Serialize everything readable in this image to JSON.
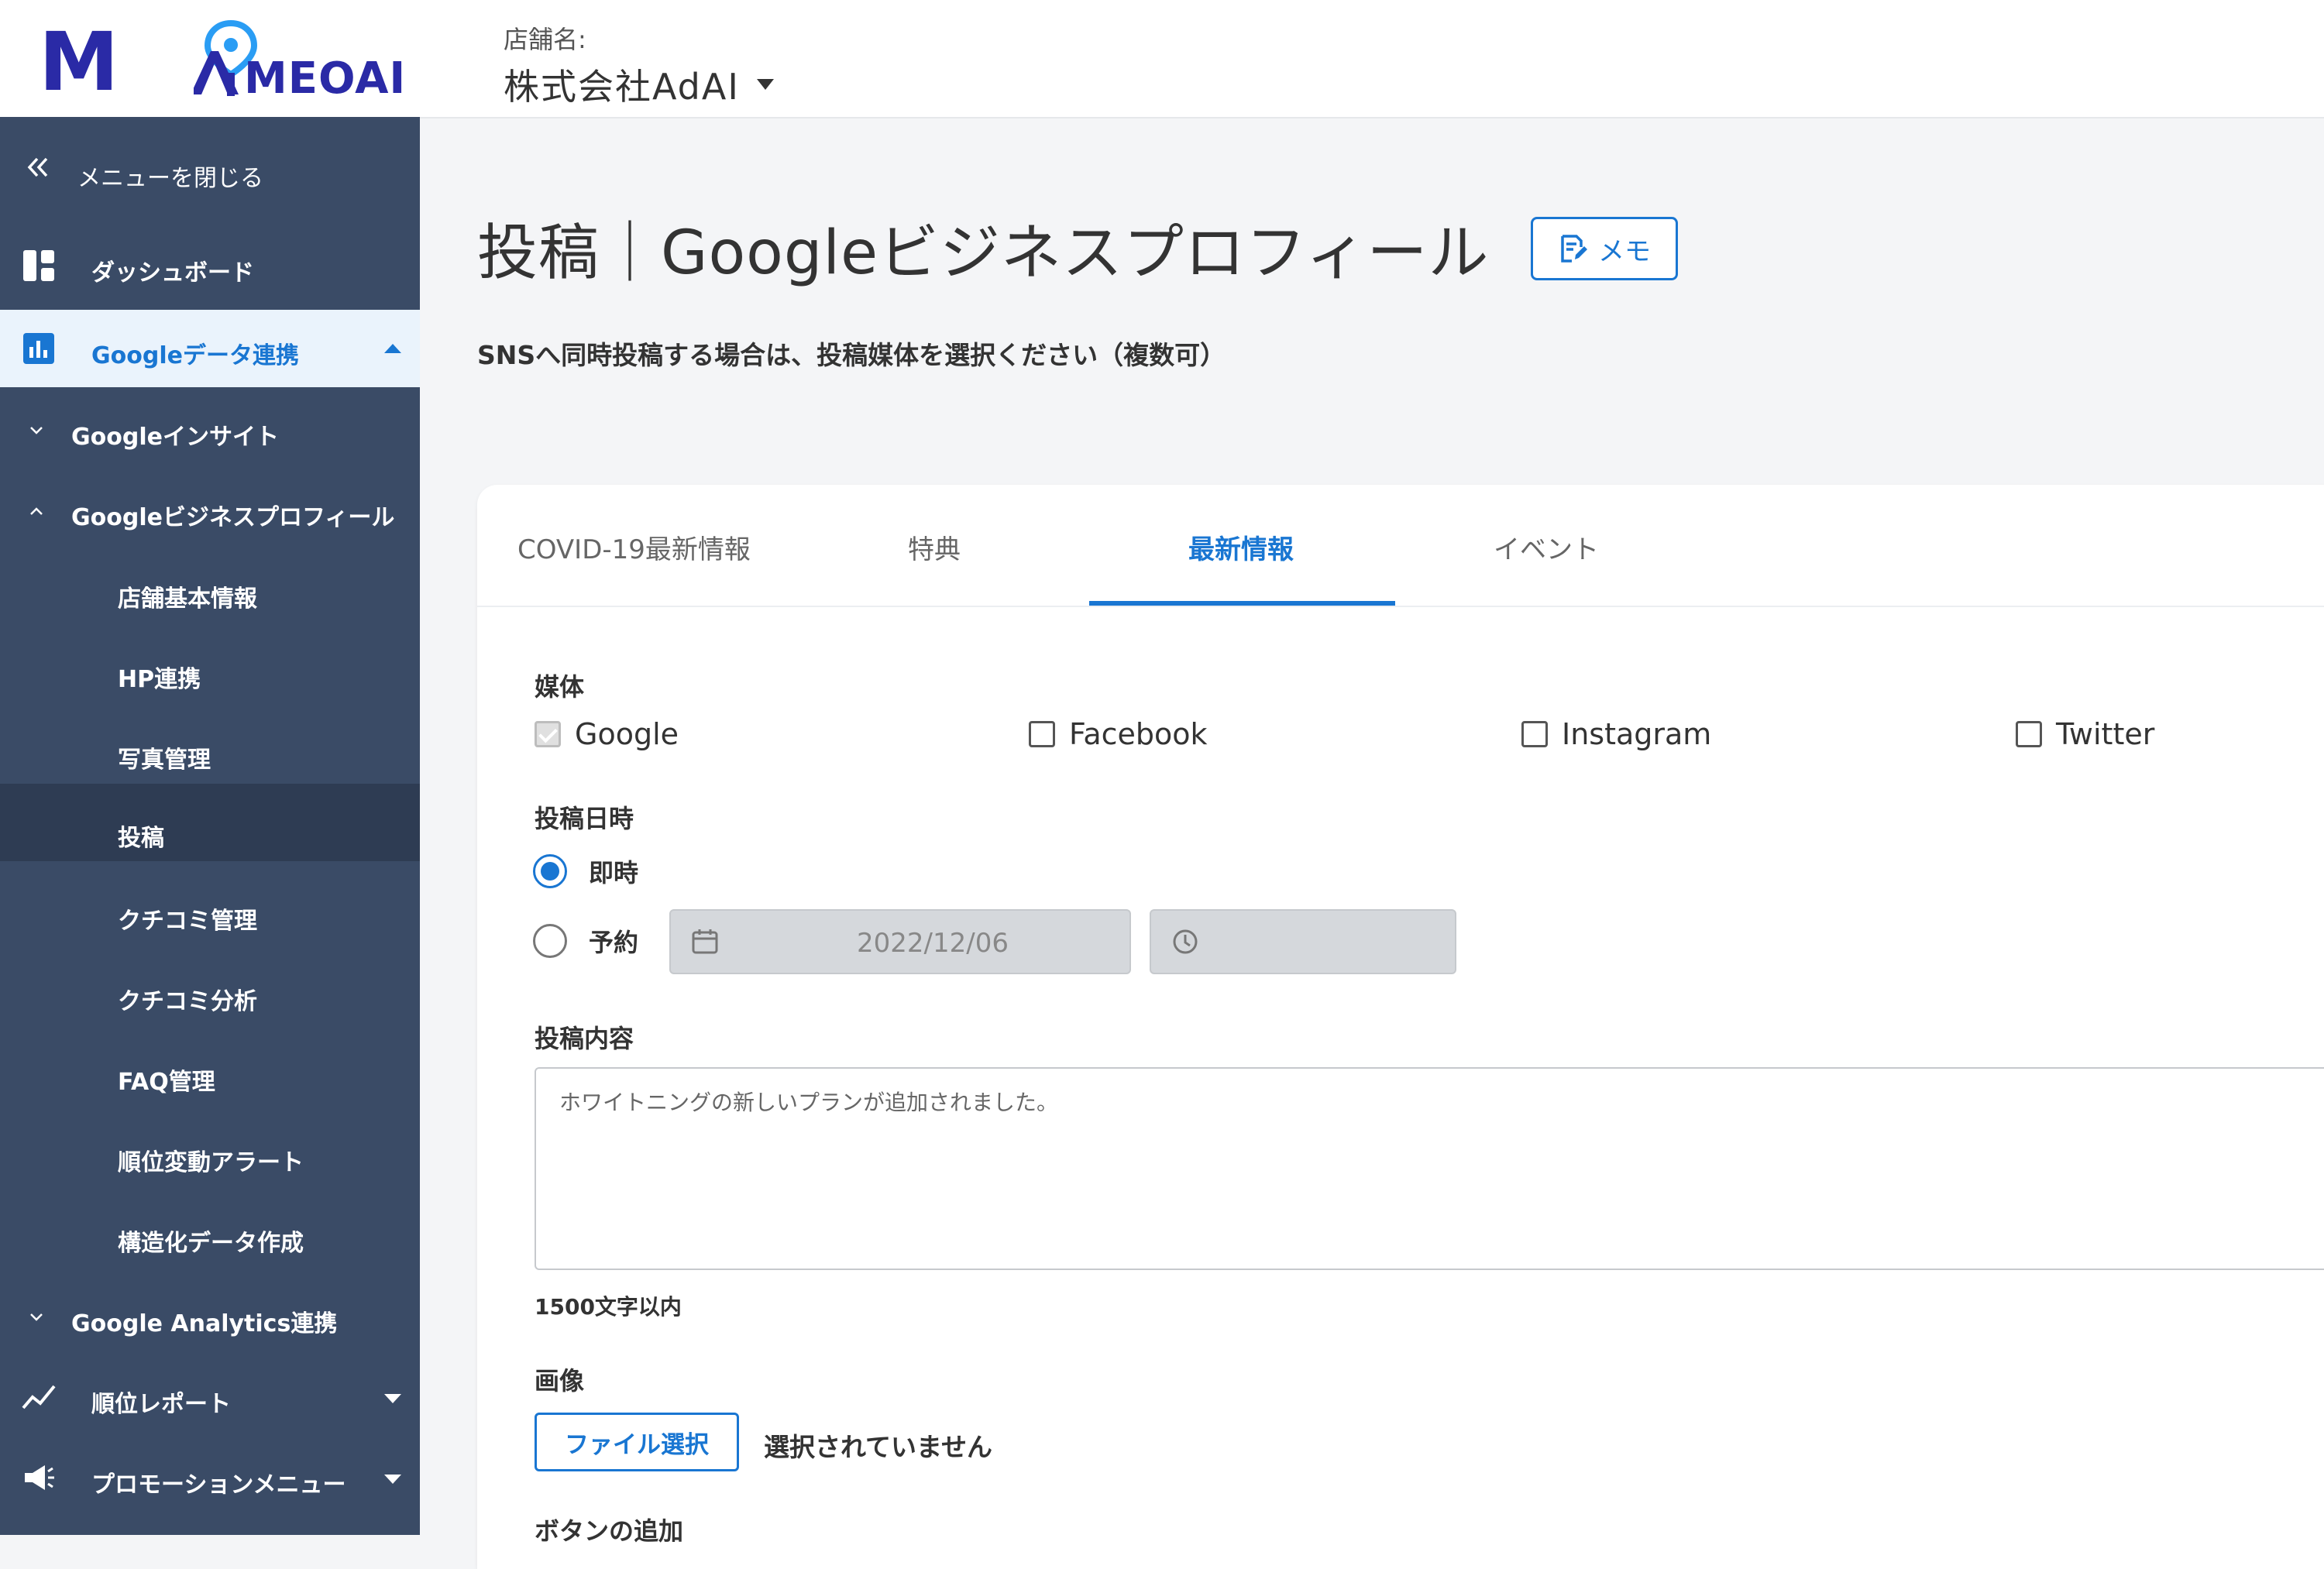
{
  "header": {
    "logo_mark": "M",
    "logo_text": "MEOAI",
    "store_label": "店舗名:",
    "store_name": "株式会社AdAI"
  },
  "sidebar": {
    "close_menu": "メニューを閉じる",
    "items": [
      {
        "label": "ダッシュボード",
        "icon": "dashboard-icon"
      },
      {
        "label": "Googleデータ連携",
        "icon": "bar-chart-icon"
      },
      {
        "label": "Googleインサイト"
      },
      {
        "label": "Googleビジネスプロフィール"
      },
      {
        "label": "店舗基本情報"
      },
      {
        "label": "HP連携"
      },
      {
        "label": "写真管理"
      },
      {
        "label": "投稿"
      },
      {
        "label": "クチコミ管理"
      },
      {
        "label": "クチコミ分析"
      },
      {
        "label": "FAQ管理"
      },
      {
        "label": "順位変動アラート"
      },
      {
        "label": "構造化データ作成"
      },
      {
        "label": "Google Analytics連携"
      },
      {
        "label": "順位レポート",
        "icon": "trend-line-icon"
      },
      {
        "label": "プロモーションメニュー",
        "icon": "megaphone-icon"
      }
    ]
  },
  "main": {
    "title": "投稿｜Googleビジネスプロフィール",
    "memo_label": "メモ",
    "subtitle": "SNSへ同時投稿する場合は、投稿媒体を選択ください（複数可）",
    "tabs": [
      {
        "label": "COVID-19最新情報"
      },
      {
        "label": "特典"
      },
      {
        "label": "最新情報"
      },
      {
        "label": "イベント"
      }
    ],
    "media_label": "媒体",
    "media": [
      {
        "label": "Google",
        "checked": true
      },
      {
        "label": "Facebook",
        "checked": false
      },
      {
        "label": "Instagram",
        "checked": false
      },
      {
        "label": "Twitter",
        "checked": false
      }
    ],
    "datetime_label": "投稿日時",
    "radio_now": "即時",
    "radio_schedule": "予約",
    "date_value": "2022/12/06",
    "content_label": "投稿内容",
    "content_value": "ホワイトニングの新しいプランが追加されました。",
    "char_limit": "1500文字以内",
    "image_label": "画像",
    "file_button": "ファイル選択",
    "file_status": "選択されていません",
    "add_button_label": "ボタンの追加"
  },
  "colors": {
    "sidebar_bg": "#3a4b66",
    "accent": "#1976d2",
    "logo": "#2a2aa6"
  }
}
